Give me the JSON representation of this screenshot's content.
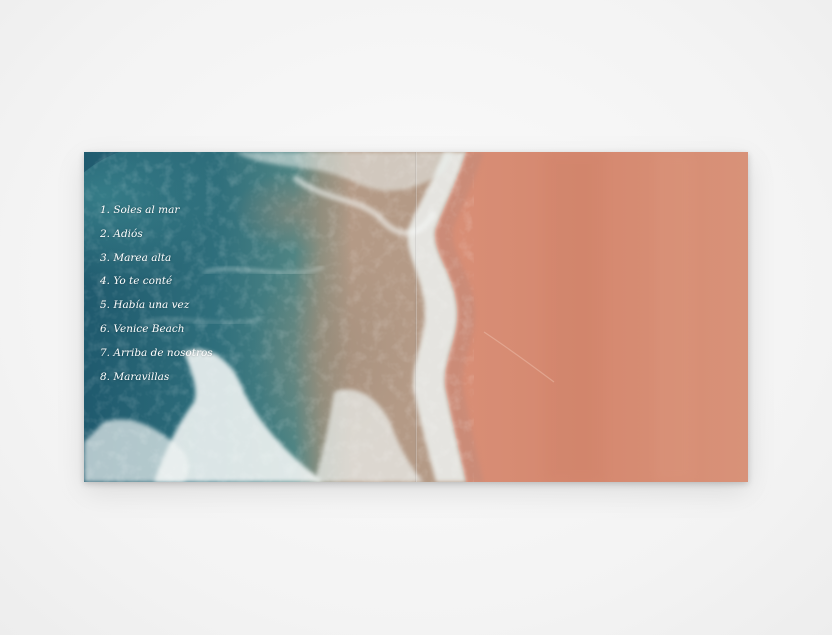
{
  "tracks": [
    "1. Soles al mar",
    "2. Adiós",
    "3. Marea alta",
    "4. Yo te conté",
    "5. Había una vez",
    "6. Venice Beach",
    "7. Arriba de nosotros",
    "8. Maravillas"
  ],
  "colors": {
    "deep_water": "#2d6b7c",
    "shallow_water": "#6a8e8a",
    "foam": "#f2f6f4",
    "wet_sand": "#c9907c",
    "sand": "#d48a72",
    "background": "#f3f3f3"
  }
}
